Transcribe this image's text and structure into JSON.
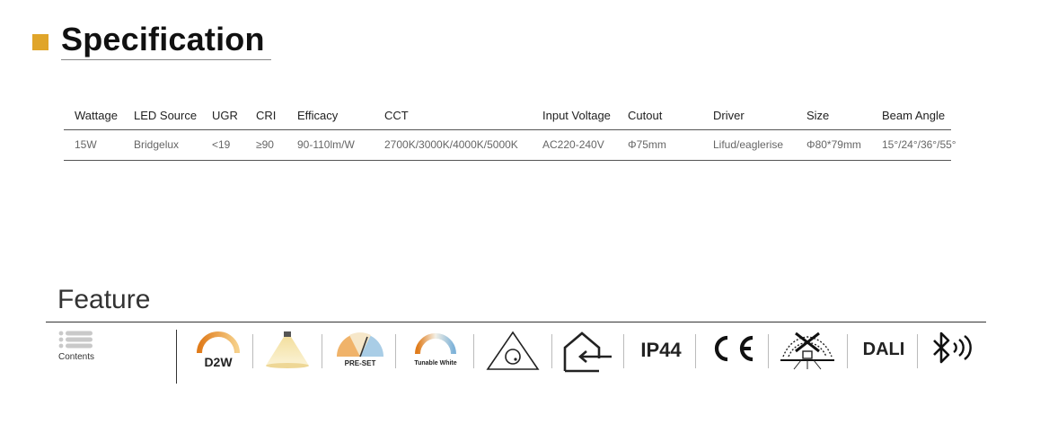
{
  "header": {
    "title": "Specification"
  },
  "spec_table": {
    "columns": [
      "Wattage",
      "LED Source",
      "UGR",
      "CRI",
      "Efficacy",
      "CCT",
      "Input Voltage",
      "Cutout",
      "Driver",
      "Size",
      "Beam Angle"
    ],
    "rows": [
      [
        "15W",
        "Bridgelux",
        "<19",
        "≥90",
        "90-110lm/W",
        "2700K/3000K/4000K/5000K",
        "AC220-240V",
        "Φ75mm",
        "Lifud/eaglerise",
        "Φ80*79mm",
        "15°/24°/36°/55°"
      ]
    ]
  },
  "feature": {
    "title": "Feature",
    "contents_label": "Contents",
    "icons": [
      {
        "name": "d2w-icon",
        "label": "D2W"
      },
      {
        "name": "downlight-beam-icon",
        "label": ""
      },
      {
        "name": "preset-icon",
        "label": "PRE-SET"
      },
      {
        "name": "tunable-white-icon",
        "label": "Tunable White"
      },
      {
        "name": "dimmable-triangle-icon",
        "label": ""
      },
      {
        "name": "indoor-house-icon",
        "label": ""
      },
      {
        "name": "ip44-icon",
        "label": "IP44"
      },
      {
        "name": "ce-mark-icon",
        "label": "CE"
      },
      {
        "name": "no-insulation-cover-icon",
        "label": ""
      },
      {
        "name": "dali-icon",
        "label": "DALI"
      },
      {
        "name": "bluetooth-icon",
        "label": ""
      }
    ]
  },
  "colors": {
    "accent": "#e0a52a",
    "text": "#222222",
    "muted": "#666666"
  }
}
